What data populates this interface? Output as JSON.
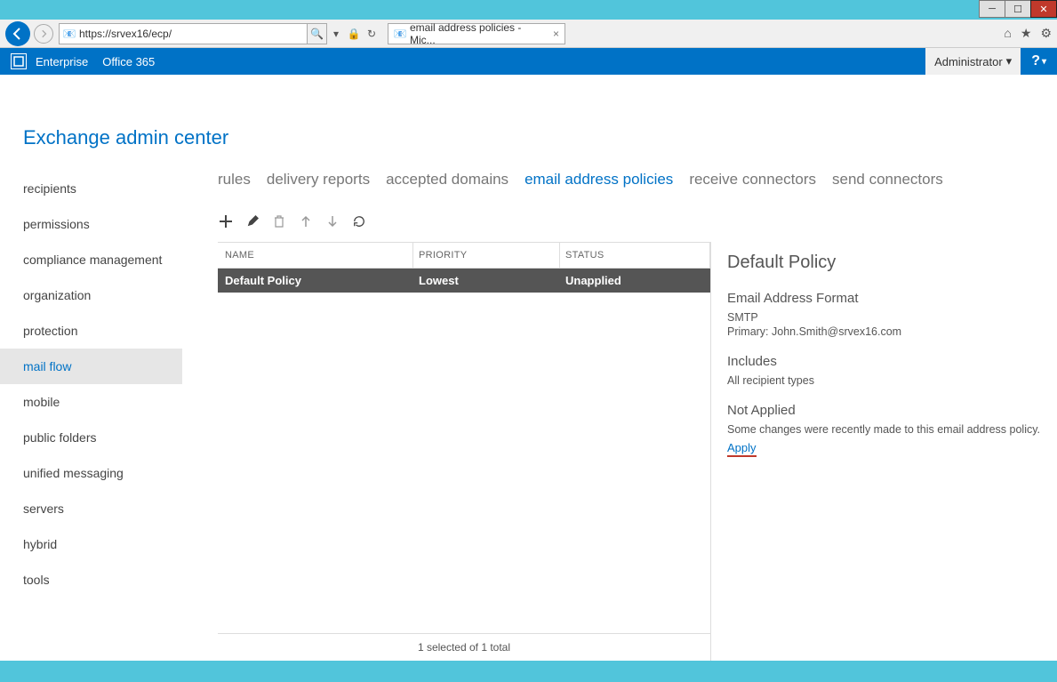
{
  "browser": {
    "url": "https://srvex16/ecp/",
    "tab_title": "email address policies - Mic..."
  },
  "o365": {
    "enterprise": "Enterprise",
    "office365": "Office 365",
    "admin_user": "Administrator"
  },
  "app_title": "Exchange admin center",
  "sidebar": {
    "items": [
      {
        "label": "recipients"
      },
      {
        "label": "permissions"
      },
      {
        "label": "compliance management"
      },
      {
        "label": "organization"
      },
      {
        "label": "protection"
      },
      {
        "label": "mail flow"
      },
      {
        "label": "mobile"
      },
      {
        "label": "public folders"
      },
      {
        "label": "unified messaging"
      },
      {
        "label": "servers"
      },
      {
        "label": "hybrid"
      },
      {
        "label": "tools"
      }
    ]
  },
  "tabs": [
    {
      "label": "rules"
    },
    {
      "label": "delivery reports"
    },
    {
      "label": "accepted domains"
    },
    {
      "label": "email address policies"
    },
    {
      "label": "receive connectors"
    },
    {
      "label": "send connectors"
    }
  ],
  "grid": {
    "headers": {
      "name": "NAME",
      "priority": "PRIORITY",
      "status": "STATUS"
    },
    "rows": [
      {
        "name": "Default Policy",
        "priority": "Lowest",
        "status": "Unapplied"
      }
    ],
    "footer": "1 selected of 1 total"
  },
  "details": {
    "title": "Default Policy",
    "format_heading": "Email Address Format",
    "smtp": "SMTP",
    "primary": "Primary: John.Smith@srvex16.com",
    "includes_heading": "Includes",
    "includes_text": "All recipient types",
    "not_applied_heading": "Not Applied",
    "not_applied_text": "Some changes were recently made to this email address policy.",
    "apply": "Apply"
  }
}
